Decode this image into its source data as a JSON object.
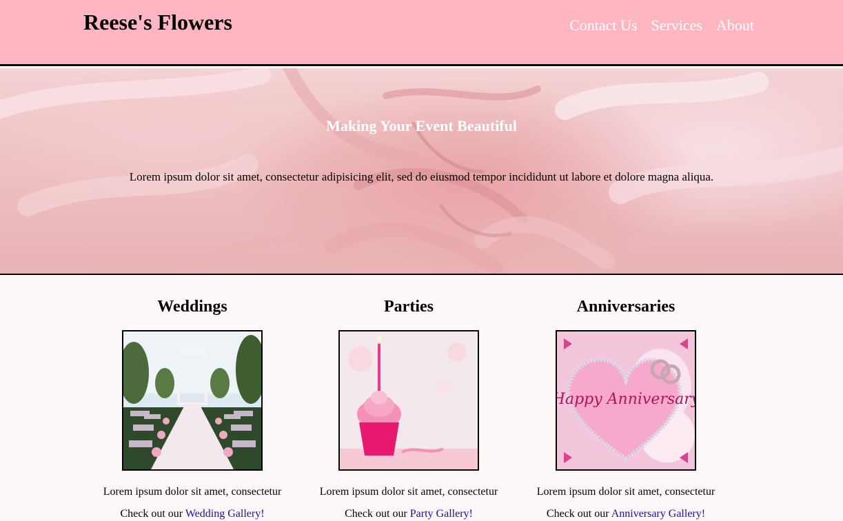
{
  "header": {
    "brand": "Reese's Flowers",
    "nav": [
      {
        "label": "Contact Us"
      },
      {
        "label": "Services"
      },
      {
        "label": "About"
      }
    ]
  },
  "hero": {
    "title": "Making Your Event Beautiful",
    "text": "Lorem ipsum dolor sit amet, consectetur adipisicing elit, sed do eiusmod tempor incididunt ut labore et dolore magna aliqua."
  },
  "cards": [
    {
      "title": "Weddings",
      "desc": "Lorem ipsum dolor sit amet, consectetur",
      "more_prefix": "Check out our ",
      "link": "Wedding Gallery!"
    },
    {
      "title": "Parties",
      "desc": "Lorem ipsum dolor sit amet, consectetur",
      "more_prefix": "Check out our ",
      "link": "Party Gallery!"
    },
    {
      "title": "Anniversaries",
      "desc": "Lorem ipsum dolor sit amet, consectetur",
      "more_prefix": "Check out our ",
      "link": "Anniversary Gallery!",
      "image_text": "Happy Anniversary"
    }
  ]
}
